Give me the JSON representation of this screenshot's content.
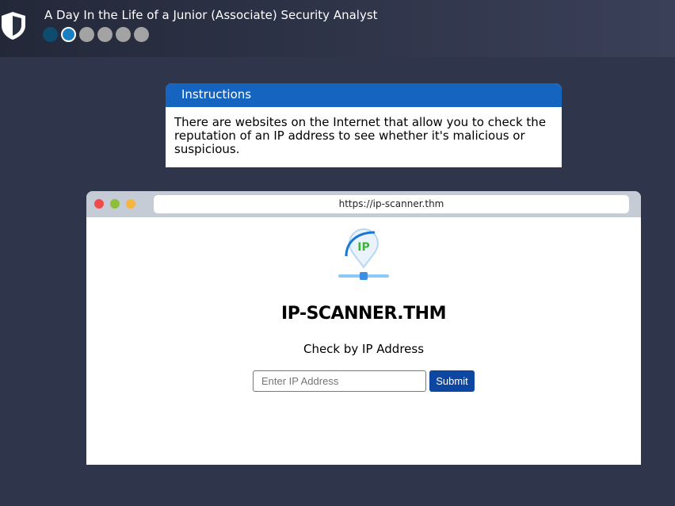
{
  "header": {
    "title": "A Day In the Life of a Junior (Associate) Security Analyst",
    "progress": {
      "completed": 1,
      "current": 2,
      "total": 6
    }
  },
  "instructions": {
    "heading": "Instructions",
    "body": "There are websites on the Internet that allow you to check the reputation of an IP address to see whether it's malicious or suspicious."
  },
  "browser": {
    "url": "https://ip-scanner.thm",
    "logo_text": "IP",
    "site_title": "IP-SCANNER.THM",
    "subtitle": "Check by IP Address",
    "input": {
      "value": "",
      "placeholder": "Enter IP Address"
    },
    "submit_label": "Submit"
  },
  "colors": {
    "accent": "#1565c0",
    "button": "#0d47a1"
  }
}
